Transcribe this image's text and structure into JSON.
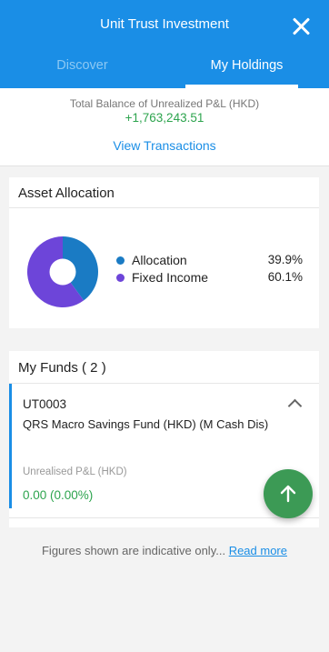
{
  "header": {
    "title": "Unit Trust Investment",
    "close_icon": "close-icon",
    "tabs": [
      {
        "label": "Discover",
        "active": false
      },
      {
        "label": "My Holdings",
        "active": true
      }
    ],
    "background_color": "#1a8ee6"
  },
  "summary": {
    "label": "Total Balance of Unrealized P&L (HKD)",
    "value": "+1,763,243.51",
    "view_transactions": "View Transactions"
  },
  "asset_allocation": {
    "title": "Asset Allocation",
    "items": [
      {
        "label": "Allocation",
        "value": "39.9%",
        "color": "#1a7bc4"
      },
      {
        "label": "Fixed Income",
        "value": "60.1%",
        "color": "#6d45d9"
      }
    ]
  },
  "funds": {
    "title": "My Funds ( 2 )",
    "items": [
      {
        "code": "UT0003",
        "name": "QRS Macro Savings Fund (HKD) (M Cash Dis)",
        "pl_label": "Unrealised P&L (HKD)",
        "pl_value": "0.00 (0.00%)"
      }
    ]
  },
  "footer": {
    "note": "Figures shown are indicative only...",
    "read_more": "Read more"
  },
  "fab": {
    "icon": "arrow-up-icon",
    "color": "#3c9a55"
  }
}
